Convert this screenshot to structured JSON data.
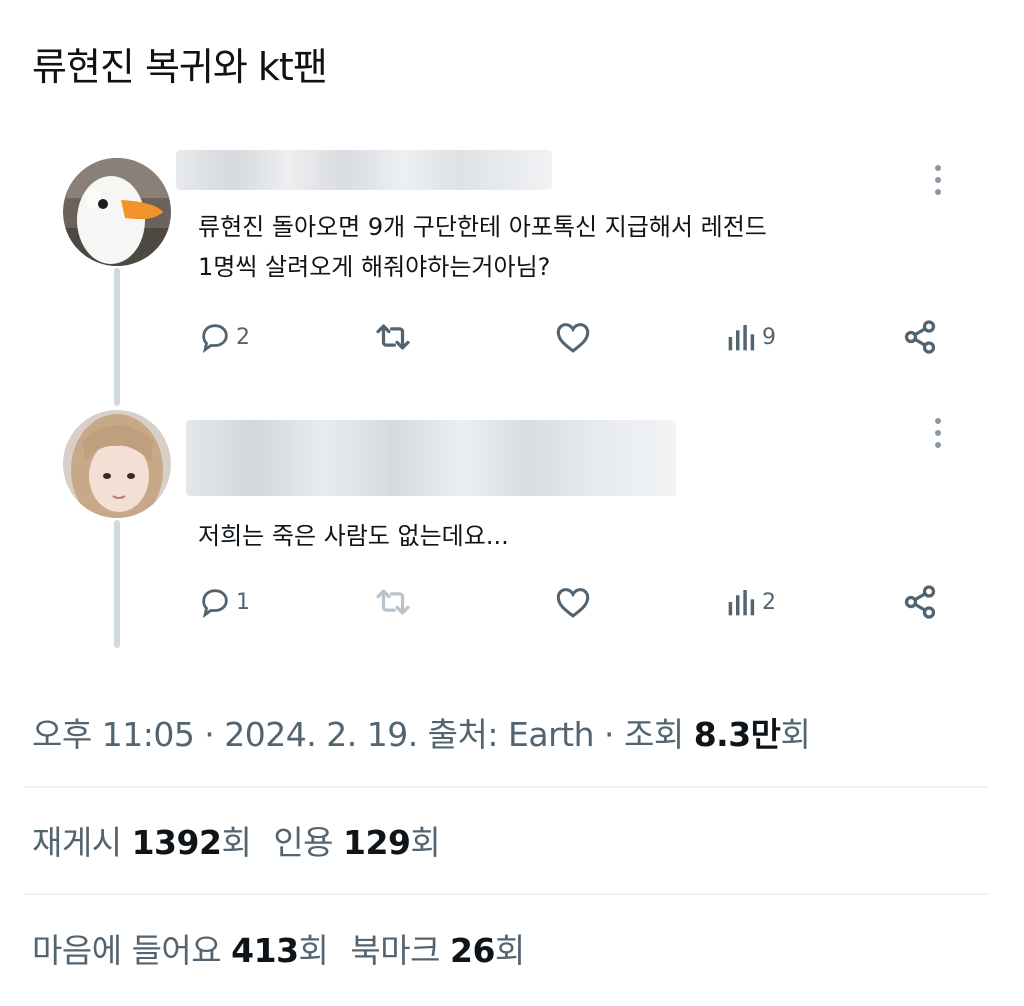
{
  "title": "류현진 복귀와 kt팬",
  "tweets": [
    {
      "text_line1": "류현진 돌아오면 9개 구단한테 아포톡신 지급해서 레전드",
      "text_line2": "1명씩 살려오게 해줘야하는거아님?",
      "replies": "2",
      "views": "9"
    },
    {
      "text_line1": "저희는 죽은 사람도 없는데요...",
      "replies": "1",
      "views": "2"
    }
  ],
  "meta": {
    "time": "오후 11:05 · 2024. 2. 19. 출처: Earth · 조회 ",
    "views_value": "8.3만",
    "views_suffix": "회"
  },
  "stats": {
    "retweets_label": "재게시 ",
    "retweets_value": "1392",
    "retweets_suffix": "회",
    "quotes_label": "인용 ",
    "quotes_value": "129",
    "quotes_suffix": "회",
    "likes_label": "마음에 들어요 ",
    "likes_value": "413",
    "likes_suffix": "회",
    "bookmarks_label": "북마크 ",
    "bookmarks_value": "26",
    "bookmarks_suffix": "회"
  },
  "colors": {
    "muted": "#536471",
    "text": "#0f1419",
    "thread_line": "#cfd9de",
    "goose_beak": "#f2922b"
  }
}
